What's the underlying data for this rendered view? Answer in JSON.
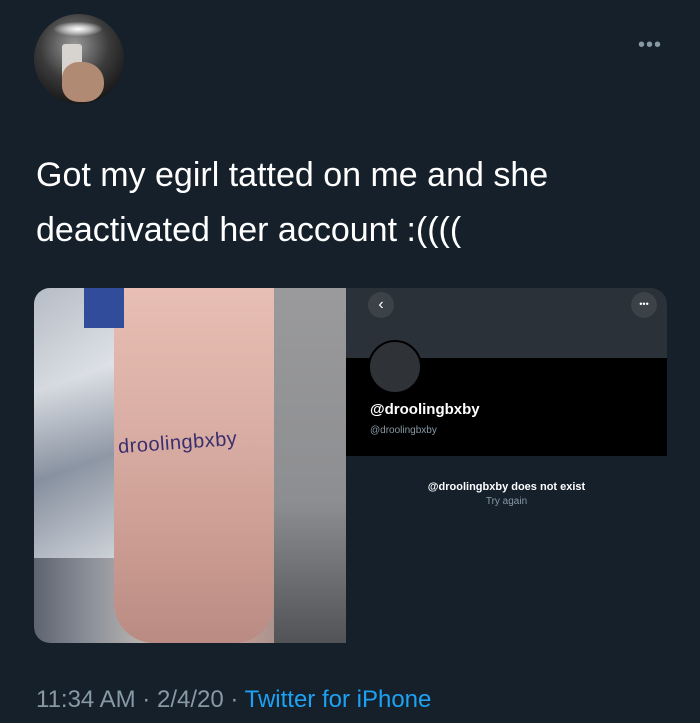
{
  "tweet": {
    "more_icon": "more-horizontal-icon",
    "text": "Got my egirl tatted on me and she deactivated her account :((((",
    "time": "11:34 AM",
    "date": "2/4/20",
    "separator": "·",
    "source": "Twitter for iPhone",
    "colors": {
      "background": "#15202b",
      "secondary_text": "#8899a6",
      "link": "#1da1f2"
    }
  },
  "photo": {
    "tattoo_text": "droolingbxby"
  },
  "screenshot": {
    "back_icon": "chevron-left-icon",
    "more_icon": "more-horizontal-icon",
    "display_handle": "@droolingbxby",
    "sub_handle": "@droolingbxby",
    "message": "@droolingbxby does not exist",
    "hint": "Try again"
  }
}
